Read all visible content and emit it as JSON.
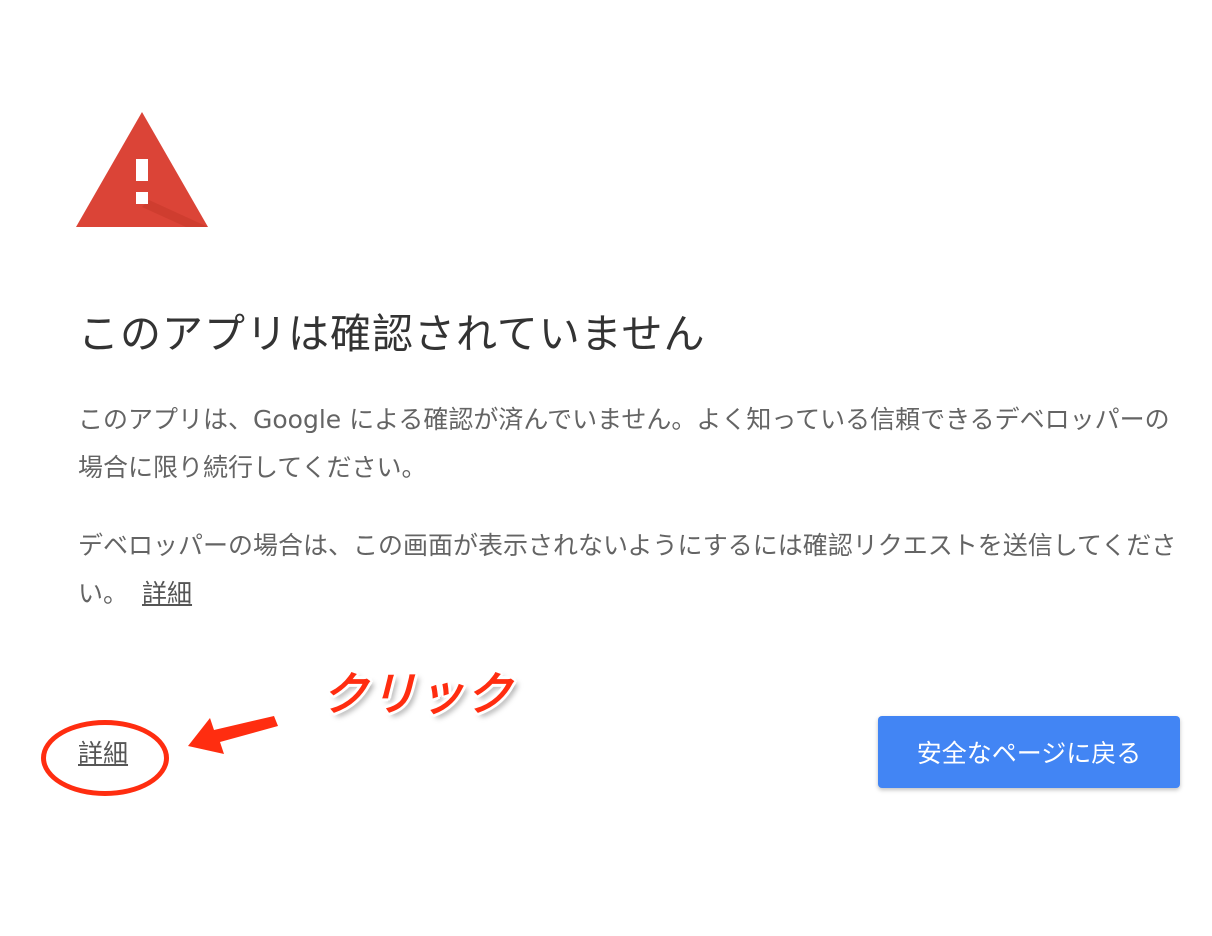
{
  "warning": {
    "icon": "warning-triangle-icon",
    "color": "#db4437"
  },
  "title": "このアプリは確認されていません",
  "body": {
    "paragraph1": "このアプリは、Google による確認が済んでいません。よく知っている信頼できるデベロッパーの場合に限り続行してください。",
    "paragraph2": "デベロッパーの場合は、この画面が表示されないようにするには確認リクエストを送信してください。",
    "inline_link": "詳細"
  },
  "actions": {
    "details_link": "詳細",
    "back_button": "安全なページに戻る",
    "button_color": "#4285f4"
  },
  "annotation": {
    "label": "クリック",
    "color": "#ff2d10"
  }
}
